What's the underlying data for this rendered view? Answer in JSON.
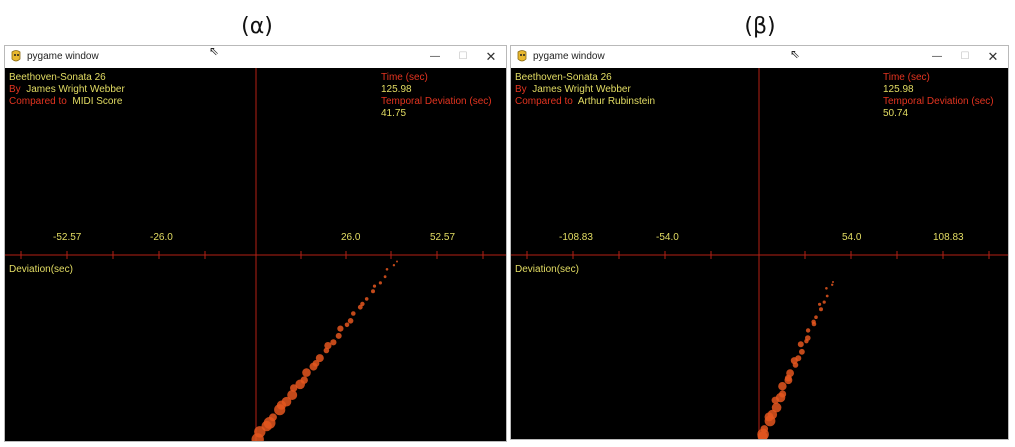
{
  "panels": [
    {
      "caption": "(α)",
      "window_title": "pygame window",
      "controls": {
        "minimize": "—",
        "maximize": "☐",
        "close": "✕"
      },
      "piece": "Beethoven-Sonata 26",
      "by_label": "By",
      "performer": "James Wright Webber",
      "compared_label": "Compared to",
      "reference": "MIDI Score",
      "time_label": "Time (sec)",
      "time_value": "125.98",
      "deviation_label": "Temporal Deviation (sec)",
      "deviation_value": "41.75",
      "x_ticks": [
        "-52.57",
        "-26.0",
        "26.0",
        "52.57"
      ],
      "y_axis_label": "Deviation(sec)"
    },
    {
      "caption": "(β)",
      "window_title": "pygame window",
      "controls": {
        "minimize": "—",
        "maximize": "☐",
        "close": "✕"
      },
      "piece": "Beethoven-Sonata 26",
      "by_label": "By",
      "performer": "James Wright Webber",
      "compared_label": "Compared to",
      "reference": "Arthur Rubinstein",
      "time_label": "Time (sec)",
      "time_value": "125.98",
      "deviation_label": "Temporal Deviation (sec)",
      "deviation_value": "50.74",
      "x_ticks": [
        "-108.83",
        "-54.0",
        "54.0",
        "108.83"
      ],
      "y_axis_label": "Deviation(sec)"
    }
  ],
  "colors": {
    "background": "#000000",
    "axis": "#b32015",
    "text_yellow": "#e3dd63",
    "text_red": "#e33420",
    "dots": "#e4561e"
  }
}
